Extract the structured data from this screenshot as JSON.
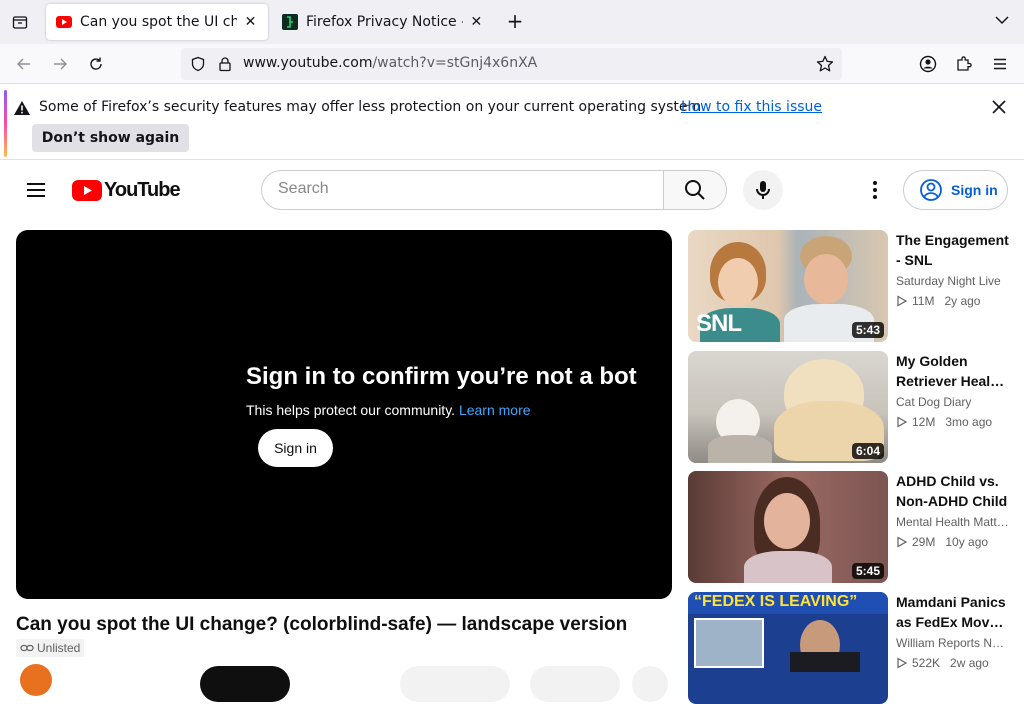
{
  "browser": {
    "tabs": [
      {
        "title": "Can you spot the UI change? (colorblind-safe) — landscape version",
        "active": true,
        "close": "✕"
      },
      {
        "title": "Firefox Privacy Notice — Mozilla",
        "active": false,
        "close": "✕"
      }
    ],
    "new_tab": "+",
    "url_host": "www.youtube.com",
    "url_path": "/watch?v=stGnj4x6nXA"
  },
  "notification": {
    "message": "Some of Firefox’s security features may offer less protection on your current operating system.",
    "link": "How to fix this issue",
    "button": "Don’t show again"
  },
  "youtube": {
    "logo_text": "YouTube",
    "search_placeholder": "Search",
    "signin_label": "Sign in",
    "player": {
      "heading": "Sign in to confirm you’re not a bot",
      "sub": "This helps protect our community.",
      "learn_more": "Learn more",
      "signin_button": "Sign in"
    },
    "video_title": "Can you spot the UI change? (colorblind-safe) — landscape version",
    "visibility_badge": "Unlisted",
    "recommendations": [
      {
        "title": "The Engagement - SNL",
        "channel": "Saturday Night Live",
        "views": "11M",
        "ago": "2y ago",
        "duration": "5:43",
        "thumb_text": "SNL"
      },
      {
        "title": "My Golden Retriever Heals a Broken Kitten",
        "channel": "Cat Dog Diary",
        "views": "12M",
        "ago": "3mo ago",
        "duration": "6:04"
      },
      {
        "title": "ADHD Child vs. Non-ADHD Child",
        "channel": "Mental Health Matters",
        "views": "29M",
        "ago": "10y ago",
        "duration": "5:45"
      },
      {
        "title": "Mamdani Panics as FedEx Moves Out",
        "channel": "William Reports News",
        "views": "522K",
        "ago": "2w ago",
        "thumb_text": "“FEDEX IS LEAVING”"
      }
    ]
  }
}
